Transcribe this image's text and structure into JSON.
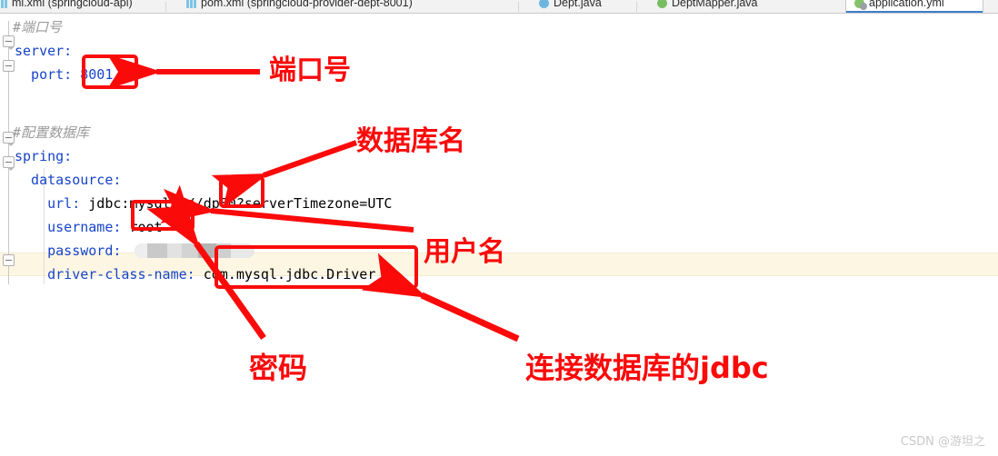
{
  "tabs": [
    {
      "label": "mi.xml (springcloud-api)",
      "icon": "xml-file-icon",
      "active": false
    },
    {
      "label": "pom.xml (springcloud-provider-dept-8001)",
      "icon": "xml-file-icon",
      "active": false
    },
    {
      "label": "Dept.java",
      "icon": "java-class-icon",
      "active": false
    },
    {
      "label": "DeptMapper.java",
      "icon": "java-interface-icon",
      "active": false
    },
    {
      "label": "application.yml",
      "icon": "yaml-file-icon",
      "active": true
    }
  ],
  "code": {
    "lines": [
      {
        "indent": 0,
        "comment": "#端口号"
      },
      {
        "indent": 0,
        "key": "server",
        "value": ""
      },
      {
        "indent": 1,
        "key": "port",
        "value": "8001"
      },
      {
        "indent": 0,
        "blank": true
      },
      {
        "indent": 0,
        "comment": "#配置数据库"
      },
      {
        "indent": 0,
        "key": "spring",
        "value": ""
      },
      {
        "indent": 1,
        "key": "datasource",
        "value": ""
      },
      {
        "indent": 2,
        "key": "url",
        "value": "jdbc:mysql:///dp80?serverTimezone=UTC"
      },
      {
        "indent": 2,
        "key": "username",
        "value": "root"
      },
      {
        "indent": 2,
        "key": "password",
        "value": "",
        "redacted": true
      },
      {
        "indent": 2,
        "key": "driver-class-name",
        "value": "com.mysql.jdbc.Driver",
        "highlighted": true
      }
    ],
    "text": {
      "comment_port": "#端口号",
      "server_key": "server:",
      "port_key": "  port: ",
      "port_value": "8001",
      "comment_db": "#配置数据库",
      "spring_key": "spring:",
      "datasource_key": "  datasource:",
      "url_key": "    url: ",
      "url_prefix": "jdbc:mysql:///",
      "url_db": "dp80",
      "url_suffix": "?serverTimezone=UTC",
      "username_key": "    username: ",
      "username_value": "root",
      "password_key": "    password: ",
      "driver_key": "    driver-class-name: ",
      "driver_value": "com.mysql.jdbc.Driver"
    }
  },
  "annotations": [
    {
      "id": "port",
      "label": "端口号",
      "target": "port-value-8001"
    },
    {
      "id": "dbname",
      "label": "数据库名",
      "target": "url-database-name"
    },
    {
      "id": "username",
      "label": "用户名",
      "target": "username-value"
    },
    {
      "id": "password",
      "label": "密码",
      "target": "password-value"
    },
    {
      "id": "jdbc",
      "label": "连接数据库的jdbc",
      "target": "driver-class-value"
    }
  ],
  "watermark": "CSDN @游坦之",
  "colors": {
    "annotation_red": "#fb0a0a",
    "yaml_key_blue": "#1744c9",
    "comment_gray": "#9a9a9a",
    "highlight_line": "#fdf6e3",
    "active_tab_underline": "#3c7fd0"
  }
}
